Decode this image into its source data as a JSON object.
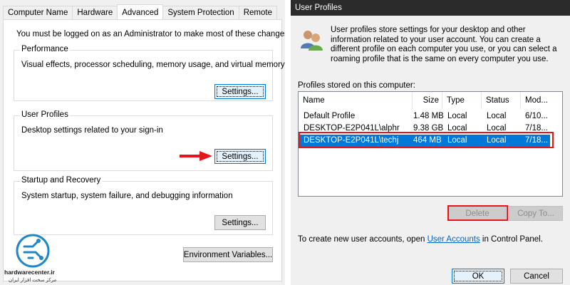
{
  "system_properties": {
    "tabs": [
      {
        "label": "Computer Name",
        "active": false
      },
      {
        "label": "Hardware",
        "active": false
      },
      {
        "label": "Advanced",
        "active": true
      },
      {
        "label": "System Protection",
        "active": false
      },
      {
        "label": "Remote",
        "active": false
      }
    ],
    "notice": "You must be logged on as an Administrator to make most of these changes.",
    "performance": {
      "title": "Performance",
      "description": "Visual effects, processor scheduling, memory usage, and virtual memory",
      "button": "Settings..."
    },
    "user_profiles": {
      "title": "User Profiles",
      "description": "Desktop settings related to your sign-in",
      "button": "Settings..."
    },
    "startup_recovery": {
      "title": "Startup and Recovery",
      "description": "System startup, system failure, and debugging information",
      "button": "Settings..."
    },
    "env_button": "Environment Variables...",
    "annotation_color": "#e8141b"
  },
  "logo": {
    "text": "hardwarecenter.ir",
    "subtext": "مرکز سخت افزار ایران",
    "color": "#1e88c9"
  },
  "user_profiles_dialog": {
    "title": "User Profiles",
    "intro": "User profiles store settings for your desktop and other information related to your user account. You can create a different profile on each computer you use, or you can select a roaming profile that is the same on every computer you use.",
    "stored_label": "Profiles stored on this computer:",
    "columns": [
      "Name",
      "Size",
      "Type",
      "Status",
      "Mod..."
    ],
    "rows": [
      {
        "name": "Default Profile",
        "size": "1.48 MB",
        "type": "Local",
        "status": "Local",
        "modified": "6/10...",
        "selected": false
      },
      {
        "name": "DESKTOP-E2P041L\\alphr",
        "size": "9.38 GB",
        "type": "Local",
        "status": "Local",
        "modified": "7/18...",
        "selected": false
      },
      {
        "name": "DESKTOP-E2P041L\\techj",
        "size": "464 MB",
        "type": "Local",
        "status": "Local",
        "modified": "7/18...",
        "selected": true
      }
    ],
    "delete_button": "Delete",
    "copy_button": "Copy To...",
    "footer_prefix": "To create new user accounts, open ",
    "footer_link": "User Accounts",
    "footer_suffix": " in Control Panel.",
    "ok_button": "OK",
    "cancel_button": "Cancel",
    "selection_color": "#0078d7",
    "highlight_color": "#e8141b"
  }
}
